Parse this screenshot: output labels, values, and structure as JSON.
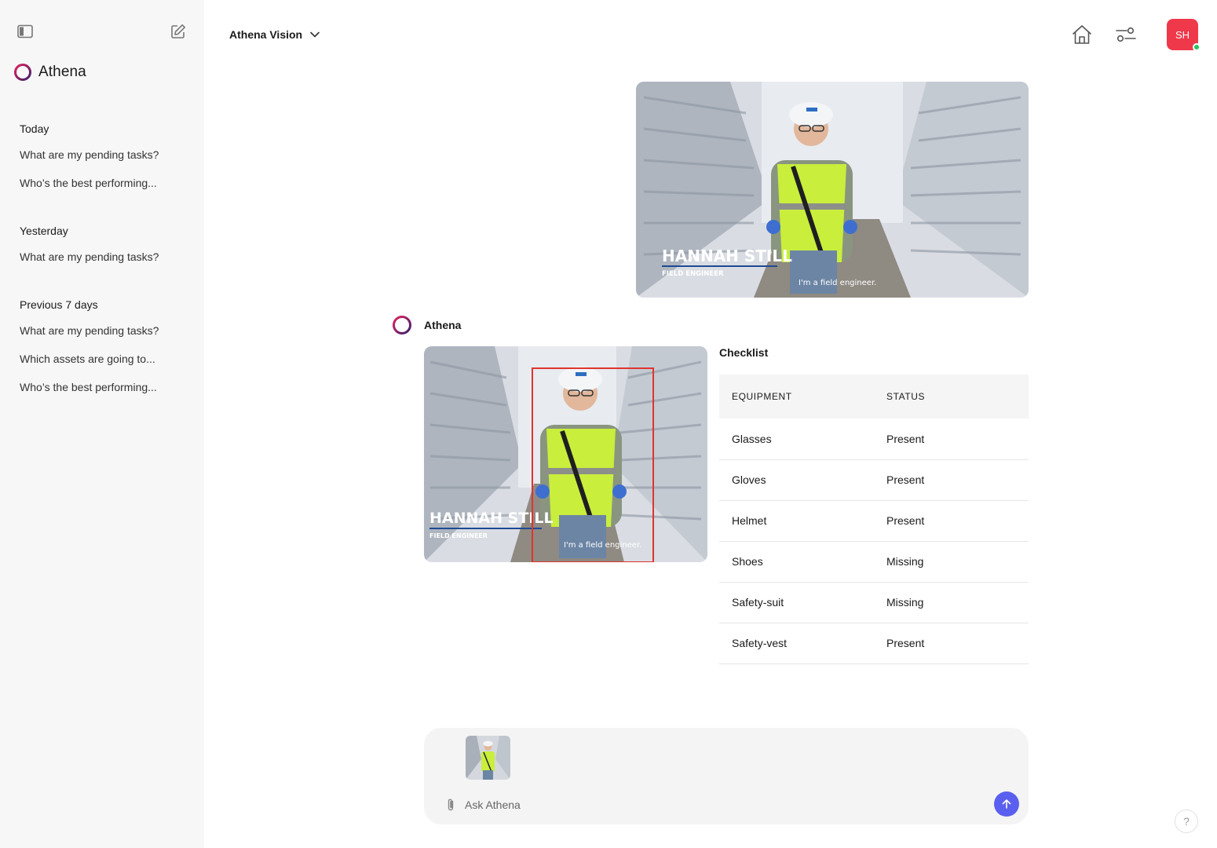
{
  "brand": {
    "name": "Athena"
  },
  "sidebar": {
    "sections": [
      {
        "heading": "Today",
        "items": [
          "What are my pending tasks?",
          "Who’s the best performing..."
        ]
      },
      {
        "heading": "Yesterday",
        "items": [
          "What are my pending tasks?"
        ]
      },
      {
        "heading": "Previous 7 days",
        "items": [
          "What are my pending tasks?",
          "Which assets are going to...",
          "Who’s the best performing..."
        ]
      }
    ]
  },
  "header": {
    "app_name": "Athena Vision",
    "avatar_initials": "SH",
    "avatar_color": "#f0384b",
    "online_color": "#22c55e"
  },
  "photo": {
    "name_text": "HANNAH STILL",
    "role_text": "FIELD ENGINEER",
    "caption_text": "I'm a field engineer."
  },
  "assistant": {
    "name": "Athena",
    "checklist": {
      "title": "Checklist",
      "columns": [
        "EQUIPMENT",
        "STATUS"
      ],
      "rows": [
        {
          "equipment": "Glasses",
          "status": "Present"
        },
        {
          "equipment": "Gloves",
          "status": "Present"
        },
        {
          "equipment": "Helmet",
          "status": "Present"
        },
        {
          "equipment": "Shoes",
          "status": "Missing"
        },
        {
          "equipment": "Safety-suit",
          "status": "Missing"
        },
        {
          "equipment": "Safety-vest",
          "status": "Present"
        }
      ],
      "colors": {
        "present": "#16a34a",
        "missing": "#e53935"
      }
    }
  },
  "composer": {
    "placeholder": "Ask Athena",
    "send_color": "#5b5fef"
  },
  "help": {
    "label": "?"
  },
  "icons": {
    "sidebar_toggle": "sidebar-toggle-icon",
    "new_chat": "edit-icon",
    "home": "home-icon",
    "filter": "sliders-icon",
    "attach": "paperclip-icon",
    "send": "arrow-up-icon"
  }
}
